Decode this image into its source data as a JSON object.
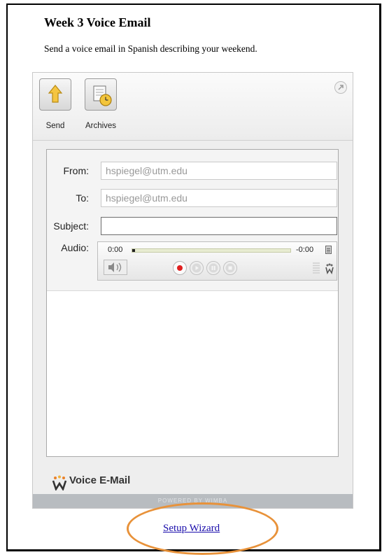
{
  "page": {
    "title": "Week 3 Voice Email",
    "subtitle": "Send a voice email in Spanish describing your weekend."
  },
  "toolbar": {
    "send_label": "Send",
    "archives_label": "Archives"
  },
  "form": {
    "from_label": "From:",
    "from_value": "hspiegel@utm.edu",
    "to_label": "To:",
    "to_value": "hspiegel@utm.edu",
    "subject_label": "Subject:",
    "subject_value": "",
    "audio_label": "Audio:"
  },
  "player": {
    "time_elapsed": "0:00",
    "time_remaining": "-0:00",
    "progress": 0
  },
  "footer": {
    "brand": "Voice E-Mail",
    "powered_by": "POWERED BY WIMBA"
  },
  "setup_link": "Setup Wizard",
  "colors": {
    "record": "#e02020",
    "link": "#1a0dab",
    "highlight": "#e8923a"
  },
  "icons": [
    "send-arrow-icon",
    "archives-clock-icon",
    "expand-icon",
    "volume-icon",
    "record-icon",
    "play-icon",
    "pause-icon",
    "stop-icon",
    "wimba-logo-icon"
  ]
}
